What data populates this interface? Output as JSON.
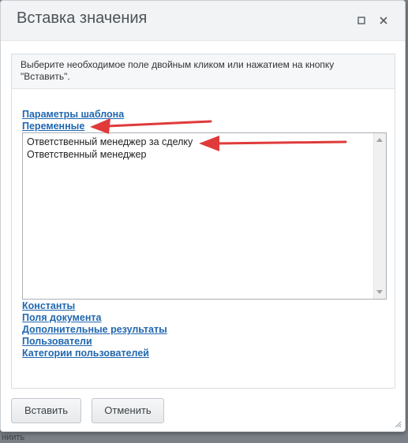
{
  "dialog": {
    "title": "Вставка значения",
    "hint": "Выберите необходимое поле двойным кликом или нажатием на кнопку \"Вставить\"."
  },
  "groups": {
    "template_params": "Параметры шаблона",
    "variables": "Переменные",
    "constants": "Константы",
    "document_fields": "Поля документа",
    "additional_results": "Дополнительные результаты",
    "users": "Пользователи",
    "user_categories": "Категории пользователей"
  },
  "variables_list": {
    "options": [
      "Ответственный менеджер за сделку",
      "Ответственный менеджер"
    ]
  },
  "buttons": {
    "insert": "Вставить",
    "cancel": "Отменить"
  },
  "background": {
    "text": "ниить"
  },
  "colors": {
    "link": "#2067b0",
    "annotation_arrow": "#e03a3a",
    "titlebar": "#f1f3f4"
  },
  "icons": {
    "maximize": "maximize-icon",
    "close": "close-icon",
    "resize": "resize-grip-icon"
  }
}
